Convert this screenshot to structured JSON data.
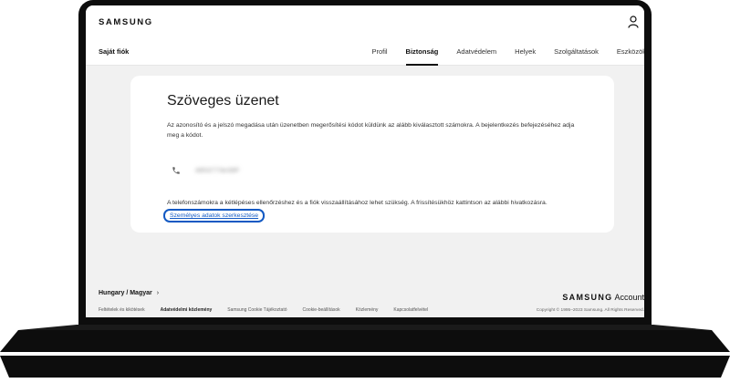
{
  "header": {
    "brand": "SAMSUNG",
    "account_title": "Saját fiók",
    "tabs": [
      {
        "label": "Profil"
      },
      {
        "label": "Biztonság"
      },
      {
        "label": "Adatvédelem"
      },
      {
        "label": "Helyek"
      },
      {
        "label": "Szolgáltatások"
      },
      {
        "label": "Eszközök"
      }
    ],
    "active_tab": "Biztonság"
  },
  "card": {
    "title": "Szöveges üzenet",
    "description": "Az azonosító és a jelszó megadása után üzenetben megerősítési kódot küldünk az alább kiválasztott számokra. A bejelentkezés befejezéséhez adja meg a kódot.",
    "phone_number": "4853773e38F",
    "note": "A telefonszámokra a kétlépéses ellenőrzéshez és a fiók visszaállításához lehet szükség. A frissítésükhöz kattintson az alábbi hivatkozásra.",
    "edit_link": "Személyes adatok szerkesztése"
  },
  "footer": {
    "region": "Hungary / Magyar",
    "region_arrow": "›",
    "links": [
      {
        "label": "Feltételek és kikötések"
      },
      {
        "label": "Adatvédelmi közlemény"
      },
      {
        "label": "Samsung Cookie Tájékoztató"
      },
      {
        "label": "Cookie-beállítások"
      },
      {
        "label": "Közlemény"
      },
      {
        "label": "Kapcsolatfelvétel"
      }
    ],
    "brand_samsung": "SAMSUNG",
    "brand_account": "Account",
    "copyright": "Copyright © 1995–2023 Samsung. All Rights Reserved."
  },
  "icons": {
    "user": "user-icon",
    "phone": "phone-icon"
  },
  "colors": {
    "link_blue": "#1259c3",
    "frame": "#0d0d0d",
    "page_bg": "#f1f1f1"
  }
}
